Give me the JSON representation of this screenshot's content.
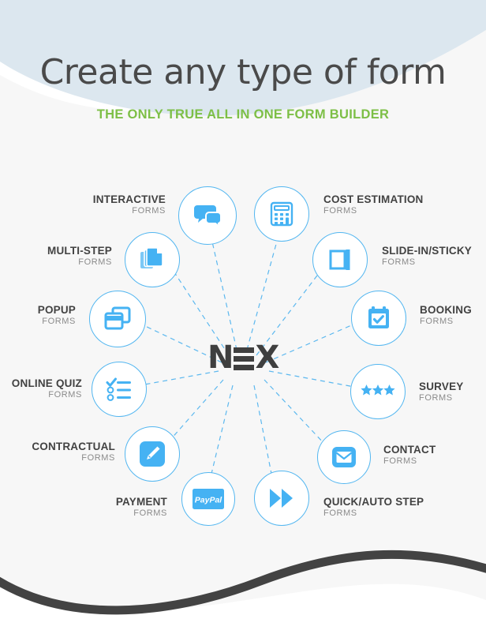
{
  "header": {
    "title": "Create any type of form",
    "subtitle": "THE ONLY TRUE ALL IN ONE FORM BUILDER",
    "title_color": "#4a4a4a",
    "subtitle_color": "#7dbf46"
  },
  "brand": {
    "logo_text_left": "N",
    "logo_text_right": "X",
    "logo_full": "NEX",
    "logo_color": "#3f3f3f"
  },
  "theme": {
    "icon_blue": "#45b2f3",
    "circle_border": "#52b6f0",
    "connector": "#5cb8ef",
    "wave_top": "#dce7ef",
    "page_bg": "#f7f7f7",
    "wave_bottom": "#434343"
  },
  "diagram": {
    "center_label": "NEX",
    "nodes": [
      {
        "id": "interactive",
        "title": "INTERACTIVE",
        "sub": "FORMS",
        "icon": "chat-bubbles-icon",
        "align": "right"
      },
      {
        "id": "cost",
        "title": "COST ESTIMATION",
        "sub": "FORMS",
        "icon": "calculator-icon",
        "align": "left"
      },
      {
        "id": "multistep",
        "title": "MULTI-STEP",
        "sub": "FORMS",
        "icon": "document-stack-icon",
        "align": "right"
      },
      {
        "id": "slidein",
        "title": "SLIDE-IN/STICKY",
        "sub": "FORMS",
        "icon": "slide-panel-icon",
        "align": "left"
      },
      {
        "id": "popup",
        "title": "POPUP",
        "sub": "FORMS",
        "icon": "windows-icon",
        "align": "right"
      },
      {
        "id": "booking",
        "title": "BOOKING",
        "sub": "FORMS",
        "icon": "calendar-check-icon",
        "align": "left"
      },
      {
        "id": "onlinequiz",
        "title": "ONLINE QUIZ",
        "sub": "FORMS",
        "icon": "checklist-icon",
        "align": "right"
      },
      {
        "id": "survey",
        "title": "SURVEY",
        "sub": "FORMS",
        "icon": "three-stars-icon",
        "align": "left"
      },
      {
        "id": "contractual",
        "title": "CONTRACTUAL",
        "sub": "FORMS",
        "icon": "pencil-icon",
        "align": "right"
      },
      {
        "id": "contact",
        "title": "CONTACT",
        "sub": "FORMS",
        "icon": "envelope-icon",
        "align": "left"
      },
      {
        "id": "payment",
        "title": "PAYMENT",
        "sub": "FORMS",
        "icon": "paypal-icon",
        "align": "right"
      },
      {
        "id": "quickauto",
        "title": "QUICK/AUTO STEP",
        "sub": "FORMS",
        "icon": "fast-forward-icon",
        "align": "left"
      }
    ],
    "paypal_label": "PayPal"
  }
}
